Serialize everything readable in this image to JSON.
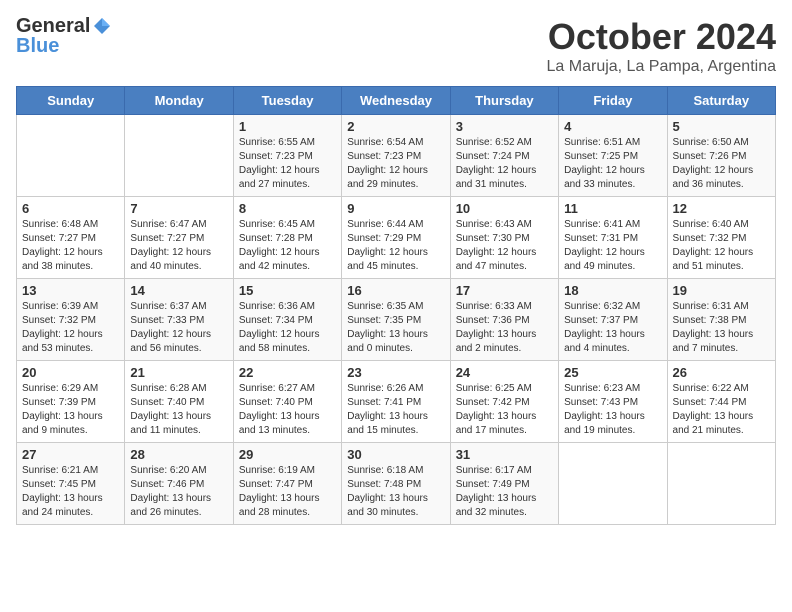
{
  "logo": {
    "general": "General",
    "blue": "Blue"
  },
  "title": {
    "month": "October 2024",
    "location": "La Maruja, La Pampa, Argentina"
  },
  "days_of_week": [
    "Sunday",
    "Monday",
    "Tuesday",
    "Wednesday",
    "Thursday",
    "Friday",
    "Saturday"
  ],
  "weeks": [
    [
      {
        "day": null,
        "info": null
      },
      {
        "day": null,
        "info": null
      },
      {
        "day": "1",
        "info": "Sunrise: 6:55 AM\nSunset: 7:23 PM\nDaylight: 12 hours and 27 minutes."
      },
      {
        "day": "2",
        "info": "Sunrise: 6:54 AM\nSunset: 7:23 PM\nDaylight: 12 hours and 29 minutes."
      },
      {
        "day": "3",
        "info": "Sunrise: 6:52 AM\nSunset: 7:24 PM\nDaylight: 12 hours and 31 minutes."
      },
      {
        "day": "4",
        "info": "Sunrise: 6:51 AM\nSunset: 7:25 PM\nDaylight: 12 hours and 33 minutes."
      },
      {
        "day": "5",
        "info": "Sunrise: 6:50 AM\nSunset: 7:26 PM\nDaylight: 12 hours and 36 minutes."
      }
    ],
    [
      {
        "day": "6",
        "info": "Sunrise: 6:48 AM\nSunset: 7:27 PM\nDaylight: 12 hours and 38 minutes."
      },
      {
        "day": "7",
        "info": "Sunrise: 6:47 AM\nSunset: 7:27 PM\nDaylight: 12 hours and 40 minutes."
      },
      {
        "day": "8",
        "info": "Sunrise: 6:45 AM\nSunset: 7:28 PM\nDaylight: 12 hours and 42 minutes."
      },
      {
        "day": "9",
        "info": "Sunrise: 6:44 AM\nSunset: 7:29 PM\nDaylight: 12 hours and 45 minutes."
      },
      {
        "day": "10",
        "info": "Sunrise: 6:43 AM\nSunset: 7:30 PM\nDaylight: 12 hours and 47 minutes."
      },
      {
        "day": "11",
        "info": "Sunrise: 6:41 AM\nSunset: 7:31 PM\nDaylight: 12 hours and 49 minutes."
      },
      {
        "day": "12",
        "info": "Sunrise: 6:40 AM\nSunset: 7:32 PM\nDaylight: 12 hours and 51 minutes."
      }
    ],
    [
      {
        "day": "13",
        "info": "Sunrise: 6:39 AM\nSunset: 7:32 PM\nDaylight: 12 hours and 53 minutes."
      },
      {
        "day": "14",
        "info": "Sunrise: 6:37 AM\nSunset: 7:33 PM\nDaylight: 12 hours and 56 minutes."
      },
      {
        "day": "15",
        "info": "Sunrise: 6:36 AM\nSunset: 7:34 PM\nDaylight: 12 hours and 58 minutes."
      },
      {
        "day": "16",
        "info": "Sunrise: 6:35 AM\nSunset: 7:35 PM\nDaylight: 13 hours and 0 minutes."
      },
      {
        "day": "17",
        "info": "Sunrise: 6:33 AM\nSunset: 7:36 PM\nDaylight: 13 hours and 2 minutes."
      },
      {
        "day": "18",
        "info": "Sunrise: 6:32 AM\nSunset: 7:37 PM\nDaylight: 13 hours and 4 minutes."
      },
      {
        "day": "19",
        "info": "Sunrise: 6:31 AM\nSunset: 7:38 PM\nDaylight: 13 hours and 7 minutes."
      }
    ],
    [
      {
        "day": "20",
        "info": "Sunrise: 6:29 AM\nSunset: 7:39 PM\nDaylight: 13 hours and 9 minutes."
      },
      {
        "day": "21",
        "info": "Sunrise: 6:28 AM\nSunset: 7:40 PM\nDaylight: 13 hours and 11 minutes."
      },
      {
        "day": "22",
        "info": "Sunrise: 6:27 AM\nSunset: 7:40 PM\nDaylight: 13 hours and 13 minutes."
      },
      {
        "day": "23",
        "info": "Sunrise: 6:26 AM\nSunset: 7:41 PM\nDaylight: 13 hours and 15 minutes."
      },
      {
        "day": "24",
        "info": "Sunrise: 6:25 AM\nSunset: 7:42 PM\nDaylight: 13 hours and 17 minutes."
      },
      {
        "day": "25",
        "info": "Sunrise: 6:23 AM\nSunset: 7:43 PM\nDaylight: 13 hours and 19 minutes."
      },
      {
        "day": "26",
        "info": "Sunrise: 6:22 AM\nSunset: 7:44 PM\nDaylight: 13 hours and 21 minutes."
      }
    ],
    [
      {
        "day": "27",
        "info": "Sunrise: 6:21 AM\nSunset: 7:45 PM\nDaylight: 13 hours and 24 minutes."
      },
      {
        "day": "28",
        "info": "Sunrise: 6:20 AM\nSunset: 7:46 PM\nDaylight: 13 hours and 26 minutes."
      },
      {
        "day": "29",
        "info": "Sunrise: 6:19 AM\nSunset: 7:47 PM\nDaylight: 13 hours and 28 minutes."
      },
      {
        "day": "30",
        "info": "Sunrise: 6:18 AM\nSunset: 7:48 PM\nDaylight: 13 hours and 30 minutes."
      },
      {
        "day": "31",
        "info": "Sunrise: 6:17 AM\nSunset: 7:49 PM\nDaylight: 13 hours and 32 minutes."
      },
      {
        "day": null,
        "info": null
      },
      {
        "day": null,
        "info": null
      }
    ]
  ]
}
